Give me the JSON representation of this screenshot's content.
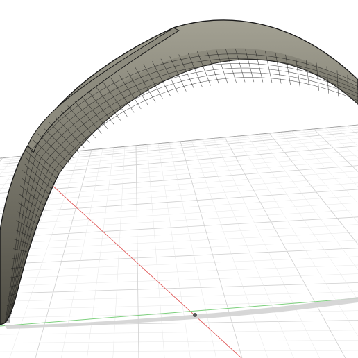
{
  "viewport": {
    "background": "#ffffff",
    "grid_minor_color": "#e6e6e6",
    "grid_major_color": "#cfcfcf",
    "x_axis_color": "#e05a5a",
    "y_axis_color": "#7ccf7c",
    "origin_marker_color": "#555555"
  },
  "model": {
    "name": "arch-shaped-surface-body",
    "surface_color": "#7a786c",
    "surface_light": "#a3a193",
    "surface_dark": "#4f4d44",
    "edge_color": "#1a1a1a",
    "shadow_color": "#d5d5d5",
    "display_mode": "shaded-with-visible-edges"
  }
}
